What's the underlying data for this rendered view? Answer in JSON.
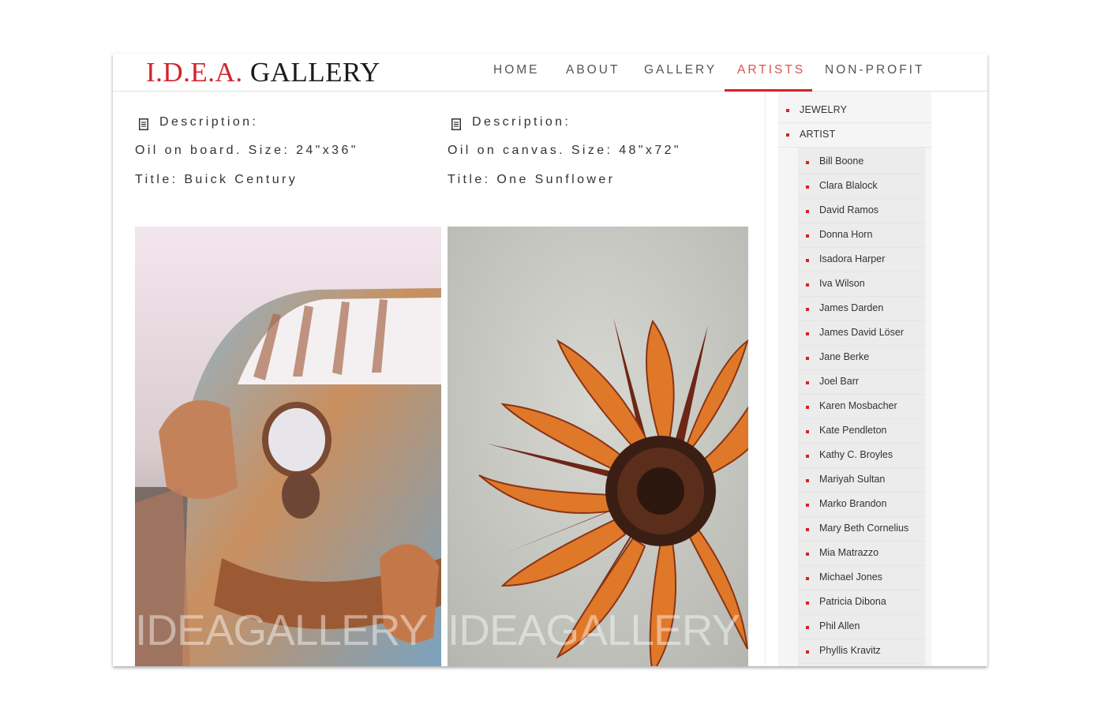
{
  "logo": {
    "part1": "I.D.E.A.",
    "part2": "GALLERY"
  },
  "nav": [
    {
      "label": "HOME"
    },
    {
      "label": "ABOUT"
    },
    {
      "label": "GALLERY"
    },
    {
      "label": "ARTISTS"
    },
    {
      "label": "NON-PROFIT"
    }
  ],
  "active_nav": "ARTISTS",
  "artworks": [
    {
      "desc_label": "Description:",
      "medium": "Oil on board. Size: 24\"x36\"",
      "title": "Title: Buick Century",
      "watermark": "IDEAGALLERY"
    },
    {
      "desc_label": "Description:",
      "medium": "Oil on canvas. Size: 48\"x72\"",
      "title": "Title: One Sunflower",
      "watermark": "IDEAGALLERY"
    }
  ],
  "sidebar": {
    "categories": [
      {
        "label": "JEWELRY"
      },
      {
        "label": "ARTIST"
      }
    ],
    "artists": [
      "Bill Boone",
      "Clara Blalock",
      "David Ramos",
      "Donna Horn",
      "Isadora Harper",
      "Iva Wilson",
      "James Darden",
      "James David Löser",
      "Jane Berke",
      "Joel Barr",
      "Karen Mosbacher",
      "Kate Pendleton",
      "Kathy C. Broyles",
      "Mariyah Sultan",
      "Marko Brandon",
      "Mary Beth Cornelius",
      "Mia Matrazzo",
      "Michael Jones",
      "Patricia Dibona",
      "Phil Allen",
      "Phyllis Kravitz"
    ]
  },
  "colors": {
    "accent": "#d2232a",
    "nav_text": "#555555",
    "sidebar_bg": "#f5f5f5"
  }
}
